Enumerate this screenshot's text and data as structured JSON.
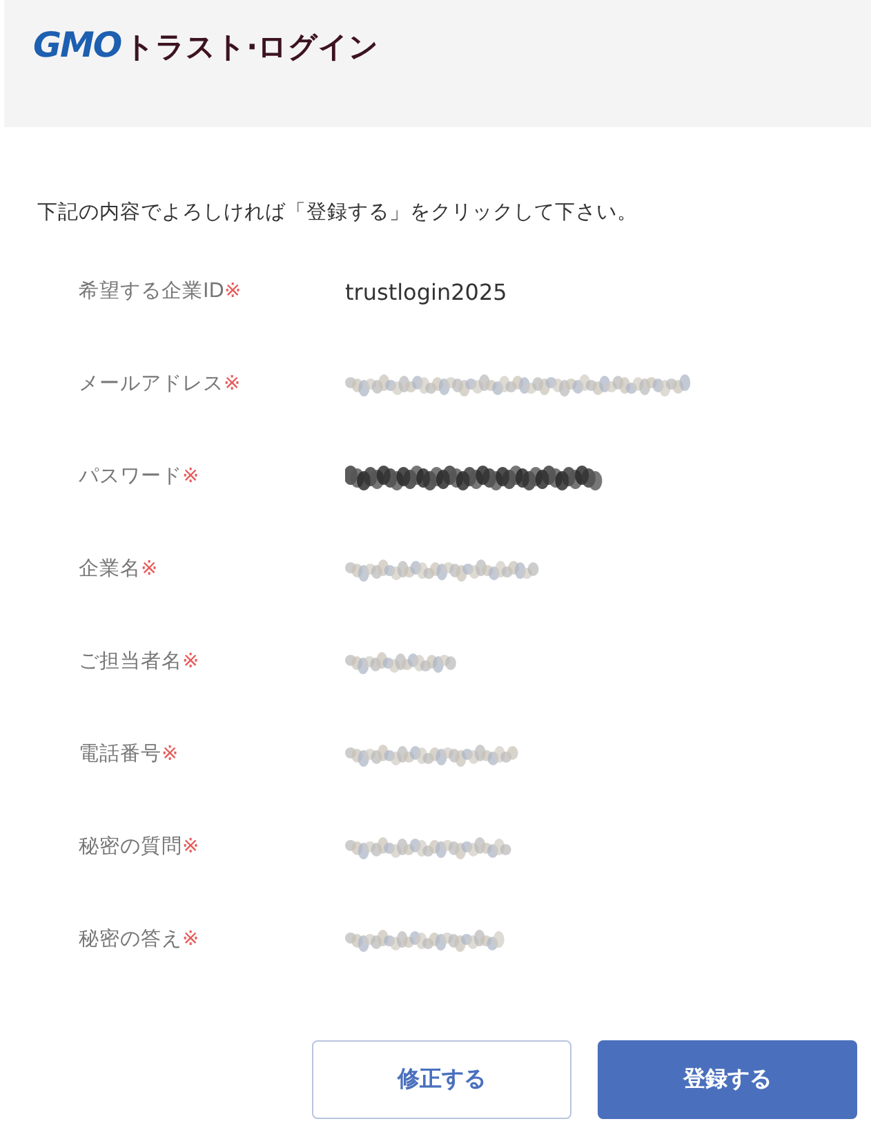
{
  "header": {
    "logo_mark": "GMO",
    "logo_text": "トラスト·ログイン"
  },
  "intro": "下記の内容でよろしければ「登録する」をクリックして下さい。",
  "fields": [
    {
      "label": "希望する企業ID",
      "required_mark": "※",
      "kind": "text",
      "value": "trustlogin2025"
    },
    {
      "label": "メールアドレス",
      "required_mark": "※",
      "kind": "redacted"
    },
    {
      "label": "パスワード",
      "required_mark": "※",
      "kind": "masked"
    },
    {
      "label": "企業名",
      "required_mark": "※",
      "kind": "redacted"
    },
    {
      "label": "ご担当者名",
      "required_mark": "※",
      "kind": "redacted"
    },
    {
      "label": "電話番号",
      "required_mark": "※",
      "kind": "redacted"
    },
    {
      "label": "秘密の質問",
      "required_mark": "※",
      "kind": "redacted"
    },
    {
      "label": "秘密の答え",
      "required_mark": "※",
      "kind": "redacted"
    }
  ],
  "buttons": [
    {
      "label": "修正する",
      "kind": "secondary"
    },
    {
      "label": "登録する",
      "kind": "primary"
    }
  ]
}
